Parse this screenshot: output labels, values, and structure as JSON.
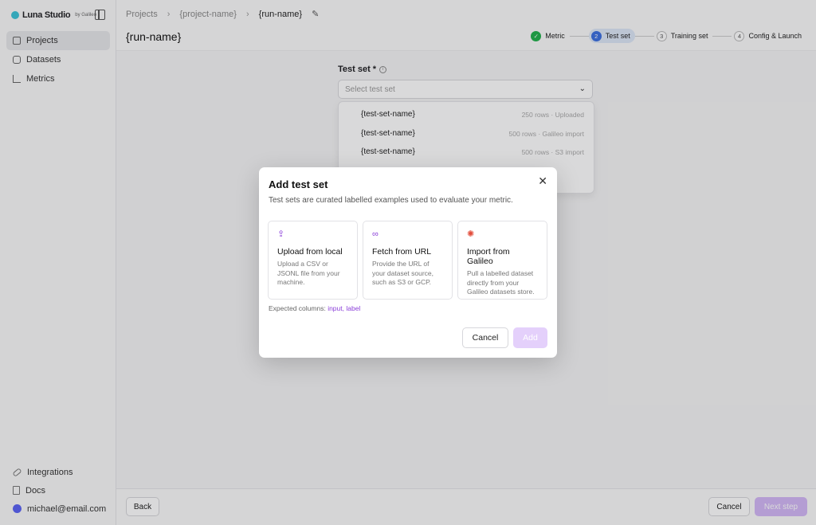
{
  "sidebar": {
    "brand_name": "Luna Studio",
    "brand_by": "by Galileo",
    "items": [
      {
        "label": "Projects",
        "icon": "folder-icon",
        "active": true
      },
      {
        "label": "Datasets",
        "icon": "database-icon"
      },
      {
        "label": "Metrics",
        "icon": "chart-icon"
      }
    ],
    "bottom_items": [
      {
        "label": "Integrations",
        "icon": "link-icon"
      },
      {
        "label": "Docs",
        "icon": "doc-icon"
      },
      {
        "label": "michael@email.com",
        "icon": "avatar-icon"
      }
    ]
  },
  "header": {
    "breadcrumb": [
      "Projects",
      "{project-name}",
      "{run-name}"
    ],
    "title": "{run-name}",
    "steps": [
      {
        "number": "✓",
        "label": "Metric",
        "state": "done"
      },
      {
        "number": "2",
        "label": "Test set",
        "state": "current"
      },
      {
        "number": "3",
        "label": "Training set",
        "state": "todo"
      },
      {
        "number": "4",
        "label": "Config & Launch",
        "state": "todo"
      }
    ]
  },
  "form": {
    "label": "Test set *",
    "placeholder": "Select test set",
    "options": [
      {
        "name": "{test-set-name}",
        "meta": "250 rows · Uploaded"
      },
      {
        "name": "{test-set-name}",
        "meta": "500 rows · Galileo import"
      },
      {
        "name": "{test-set-name}",
        "meta": "500 rows · S3 import"
      }
    ]
  },
  "footer": {
    "back_label": "Back",
    "cancel_label": "Cancel",
    "next_label": "Next step"
  },
  "modal": {
    "title": "Add test set",
    "description": "Test sets are curated labelled examples used to evaluate your metric.",
    "cards": [
      {
        "icon": "upload-icon",
        "title": "Upload from local",
        "description": "Upload a CSV or JSONL file from your machine."
      },
      {
        "icon": "link-icon",
        "title": "Fetch from URL",
        "description": "Provide the URL of your dataset source, such as S3 or GCP."
      },
      {
        "icon": "galileo-icon",
        "title": "Import from Galileo",
        "description": "Pull a labelled dataset directly from your Galileo datasets store."
      }
    ],
    "expected_prefix": "Expected columns: ",
    "expected_col1": "input",
    "expected_sep": ", ",
    "expected_col2": "label",
    "cancel_label": "Cancel",
    "add_label": "Add"
  },
  "colors": {
    "accent": "#8b3fd9",
    "primary_disabled": "#e4d0fb",
    "step_done": "#22b14c",
    "step_current": "#3b6fe0"
  }
}
